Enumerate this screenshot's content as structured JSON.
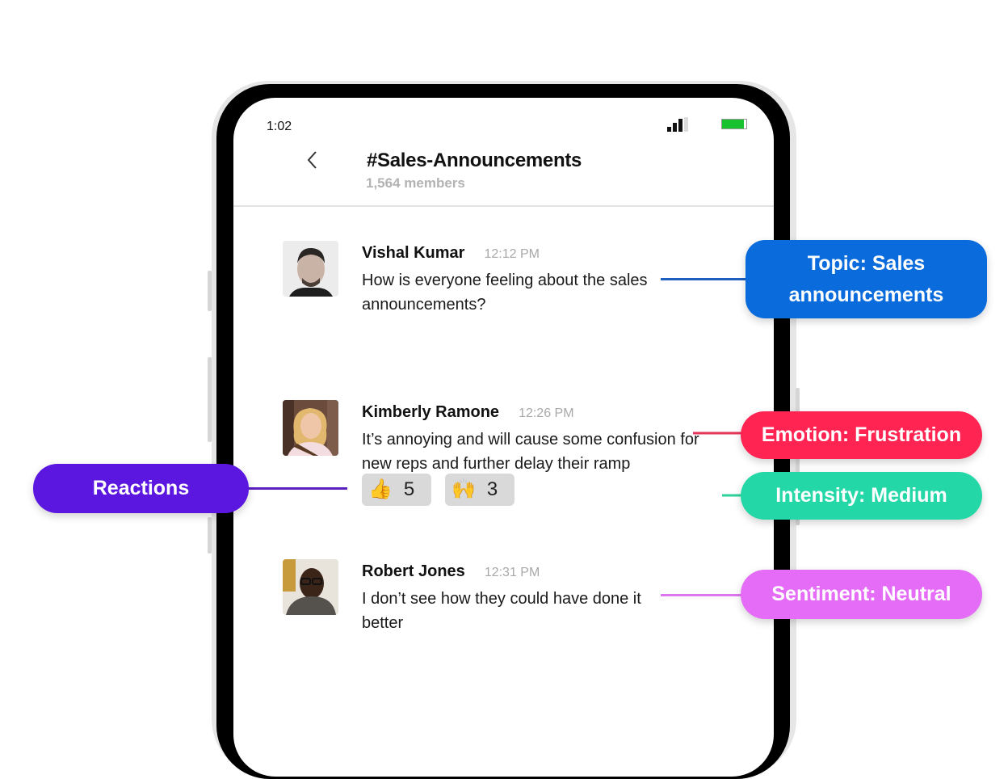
{
  "status_bar": {
    "time": "1:02",
    "signal_icon": "signal-bars-icon",
    "battery_icon": "battery-icon",
    "battery_color": "#18c22e"
  },
  "header": {
    "back_icon": "chevron-left-icon",
    "channel_name": "#Sales-Announcements",
    "members": "1,564 members"
  },
  "messages": [
    {
      "author": "Vishal Kumar",
      "time": "12:12 PM",
      "text": "How is everyone feeling about the sales announcements?",
      "avatar": "avatar-vishal-kumar"
    },
    {
      "author": "Kimberly Ramone",
      "time": "12:26 PM",
      "text": "It’s annoying and will cause some confusion for new reps and further delay their ramp",
      "avatar": "avatar-kimberly-ramone",
      "reactions": [
        {
          "emoji": "👍",
          "icon": "thumbs-up-icon",
          "count": "5"
        },
        {
          "emoji": "🙌",
          "icon": "raised-hands-icon",
          "count": "3"
        }
      ]
    },
    {
      "author": "Robert Jones",
      "time": "12:31 PM",
      "text": "I don’t see how they could have done it better",
      "avatar": "avatar-robert-jones"
    }
  ],
  "callouts": {
    "topic": {
      "label": "Topic: Sales announcements",
      "line1": "Topic: Sales",
      "line2": "announcements",
      "color": "#0a6bdc"
    },
    "emotion": {
      "label": "Emotion: Frustration",
      "color": "#ff2452"
    },
    "intensity": {
      "label": "Intensity: Medium",
      "color": "#23d8a6"
    },
    "reactions": {
      "label": "Reactions",
      "color": "#5b17e0"
    },
    "sentiment": {
      "label": "Sentiment: Neutral",
      "color": "#e46cf7"
    }
  }
}
